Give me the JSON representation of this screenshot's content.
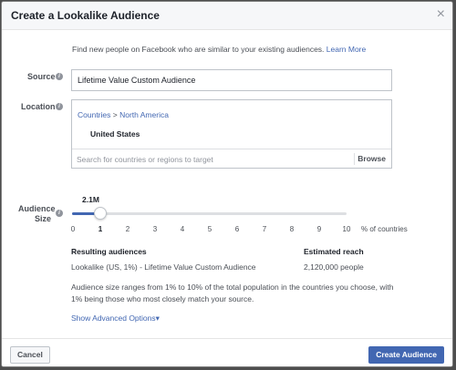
{
  "dialog": {
    "title": "Create a Lookalike Audience",
    "close_glyph": "×"
  },
  "intro": {
    "text": "Find new people on Facebook who are similar to your existing audiences. ",
    "link": "Learn More"
  },
  "source": {
    "label": "Source",
    "value": "Lifetime Value Custom Audience"
  },
  "location": {
    "label": "Location",
    "breadcrumb_root": "Countries",
    "breadcrumb_sep": " > ",
    "breadcrumb_region": "North America",
    "selected_country": "United States",
    "search_placeholder": "Search for countries or regions to target",
    "browse_label": "Browse"
  },
  "audience_size": {
    "label_line1": "Audience",
    "label_line2": "Size",
    "current_estimate": "2.1M",
    "selected_percent": 1,
    "ticks": [
      "0",
      "1",
      "2",
      "3",
      "4",
      "5",
      "6",
      "7",
      "8",
      "9",
      "10"
    ],
    "suffix": "% of countries"
  },
  "results": {
    "header_audiences": "Resulting audiences",
    "header_reach": "Estimated reach",
    "audience_value": "Lookalike (US, 1%) - Lifetime Value Custom Audience",
    "reach_value": "2,120,000 people"
  },
  "note": "Audience size ranges from 1% to 10% of the total population in the countries you choose, with 1% being those who most closely match your source.",
  "advanced_link": "Show Advanced Options",
  "advanced_caret": "▾",
  "footer": {
    "cancel_label": "Cancel",
    "create_label": "Create Audience"
  },
  "colors": {
    "brand_blue": "#4267b2",
    "backdrop": "#4e4e4e"
  }
}
